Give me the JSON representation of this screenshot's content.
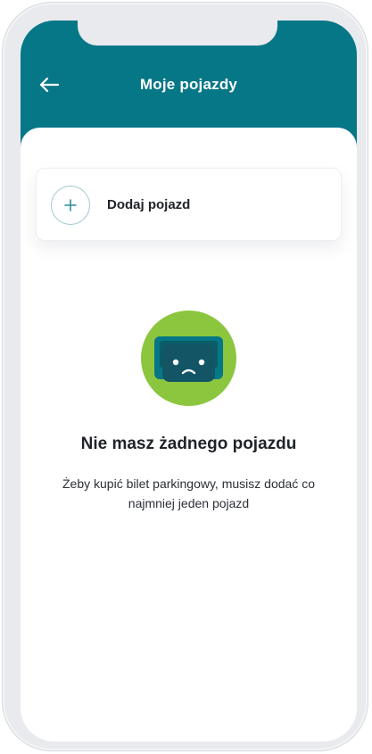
{
  "header": {
    "title": "Moje pojazdy",
    "back_icon": "arrow-left-icon",
    "background_color": "#067787"
  },
  "add_vehicle": {
    "label": "Dodaj pojazd",
    "icon": "plus-icon"
  },
  "empty_state": {
    "illustration": "sad-car-icon",
    "illustration_color": "#8cc63f",
    "title": "Nie masz żadnego pojazdu",
    "description": "Żeby kupić bilet parkingowy, musisz dodać co najmniej jeden pojazd"
  }
}
